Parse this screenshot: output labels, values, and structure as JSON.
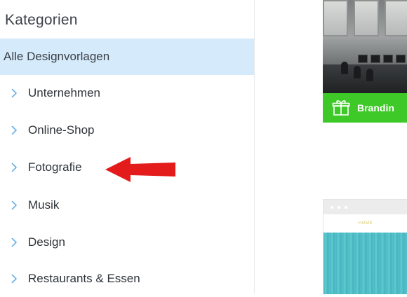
{
  "sidebar": {
    "title": "Kategorien",
    "items": [
      {
        "label": "Alle Designvorlagen",
        "active": true
      },
      {
        "label": "Unternehmen"
      },
      {
        "label": "Online-Shop"
      },
      {
        "label": "Fotografie"
      },
      {
        "label": "Musik"
      },
      {
        "label": "Design"
      },
      {
        "label": "Restaurants & Essen"
      }
    ]
  },
  "cards": {
    "branding_label": "Brandin",
    "home_label": "HOME"
  },
  "icons": {
    "chevron": "chevron-right-icon",
    "gift": "gift-box-icon",
    "arrow": "red-arrow-left-icon"
  },
  "colors": {
    "active_bg": "#d5eafa",
    "chevron": "#58a6df",
    "green": "#3ec928",
    "arrow": "#e31b1b",
    "teal": "#52bec7"
  }
}
